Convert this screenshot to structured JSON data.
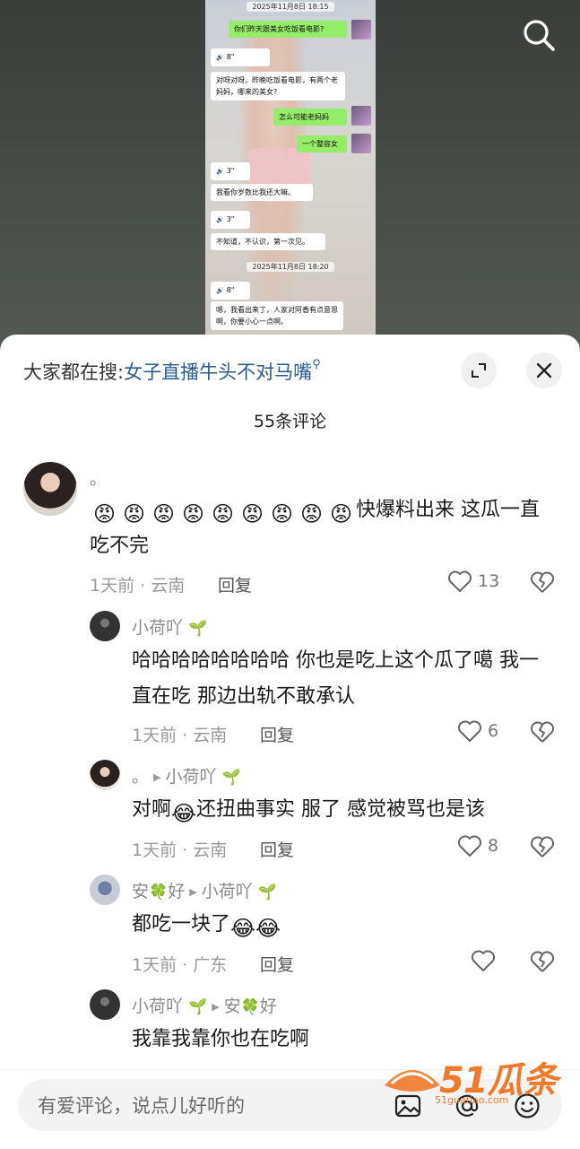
{
  "video": {
    "chat": {
      "timestamp1": "2025年11月8日 18:15",
      "msg1": "你们昨天跟美女吃饭看电影?",
      "voice1": "8\"",
      "msg2": "对呀对呀，昨晚吃饭看电影，有两个老妈妈，哪来的美女?",
      "msg3": "怎么可能老妈妈",
      "msg4": "一个整容女",
      "voice2": "3\"",
      "msg5": "我看你岁数比我还大嘛。",
      "voice3": "3\"",
      "msg6": "不知道，不认识，第一次见。",
      "timestamp2": "2025年11月8日 18:20",
      "voice4": "8\"",
      "msg7": "嗯，我看出来了，人家对阿香有点意思啊，你要小心一点啊。"
    }
  },
  "sheet": {
    "hot_search_prefix": "大家都在搜:",
    "hot_search_keyword": "女子直播牛头不对马嘴",
    "comment_count": "55条评论"
  },
  "comments": [
    {
      "username": "。",
      "emoji_count": 9,
      "text_after_emoji": "快爆料出来  这瓜一直吃不完",
      "time_location": "1天前 · 云南",
      "reply_label": "回复",
      "likes": "13"
    },
    {
      "username": "小荷吖",
      "text": "哈哈哈哈哈哈哈哈  你也是吃上这个瓜了噶 我一直在吃  那边出轨不敢承认",
      "time_location": "1天前 · 云南",
      "reply_label": "回复",
      "likes": "6"
    },
    {
      "username": "。",
      "reply_to": "小荷吖",
      "text_before_emoji": "对啊",
      "text_after_emoji": "还扭曲事实  服了  感觉被骂也是该",
      "time_location": "1天前 · 云南",
      "reply_label": "回复",
      "likes": "8"
    },
    {
      "username_a": "安",
      "username_b": "好",
      "reply_to": "小荷吖",
      "text": "都吃一块了",
      "time_location": "1天前 · 广东",
      "reply_label": "回复",
      "likes": ""
    },
    {
      "username": "小荷吖",
      "reply_to_a": "安",
      "reply_to_b": "好",
      "text": "我靠我靠你也在吃啊"
    }
  ],
  "input": {
    "placeholder": "有爱评论，说点儿好听的"
  },
  "watermark": {
    "brand": "51瓜条",
    "url": "51guatiao.com"
  },
  "icons": {
    "search": "search-icon",
    "expand": "expand-icon",
    "close": "close-icon",
    "heart": "heart-icon",
    "dislike": "broken-heart-icon",
    "image": "image-icon",
    "mention": "at-icon",
    "emoji": "emoji-icon"
  },
  "colors": {
    "keyword": "#2b5c8f",
    "chat_green": "#95ec69",
    "watermark": "#f07a2a"
  }
}
